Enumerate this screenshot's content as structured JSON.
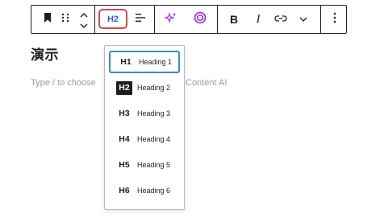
{
  "toolbar": {
    "h2_label": "H2",
    "bold_label": "B",
    "italic_label": "I",
    "accent_color": "#3858e9",
    "highlight_color": "#d84a4a",
    "ai_color": "#a020f0",
    "icons": [
      "bookmark-icon",
      "drag-handle-icon",
      "move-up-icon",
      "move-down-icon",
      "align-icon",
      "sparkle-icon",
      "ai-content-icon",
      "link-icon",
      "chevron-down-icon",
      "more-options-icon"
    ]
  },
  "editor": {
    "title": "演示",
    "placeholder_left": "Type / to choose",
    "placeholder_right": "Content AI"
  },
  "heading_menu": {
    "selected": "Heading 1",
    "items": [
      {
        "tag": "H1",
        "label": "Heading 1"
      },
      {
        "tag": "H2",
        "label": "Heading 2"
      },
      {
        "tag": "H3",
        "label": "Heading 3"
      },
      {
        "tag": "H4",
        "label": "Heading 4"
      },
      {
        "tag": "H5",
        "label": "Heading 5"
      },
      {
        "tag": "H6",
        "label": "Heading 6"
      }
    ]
  }
}
